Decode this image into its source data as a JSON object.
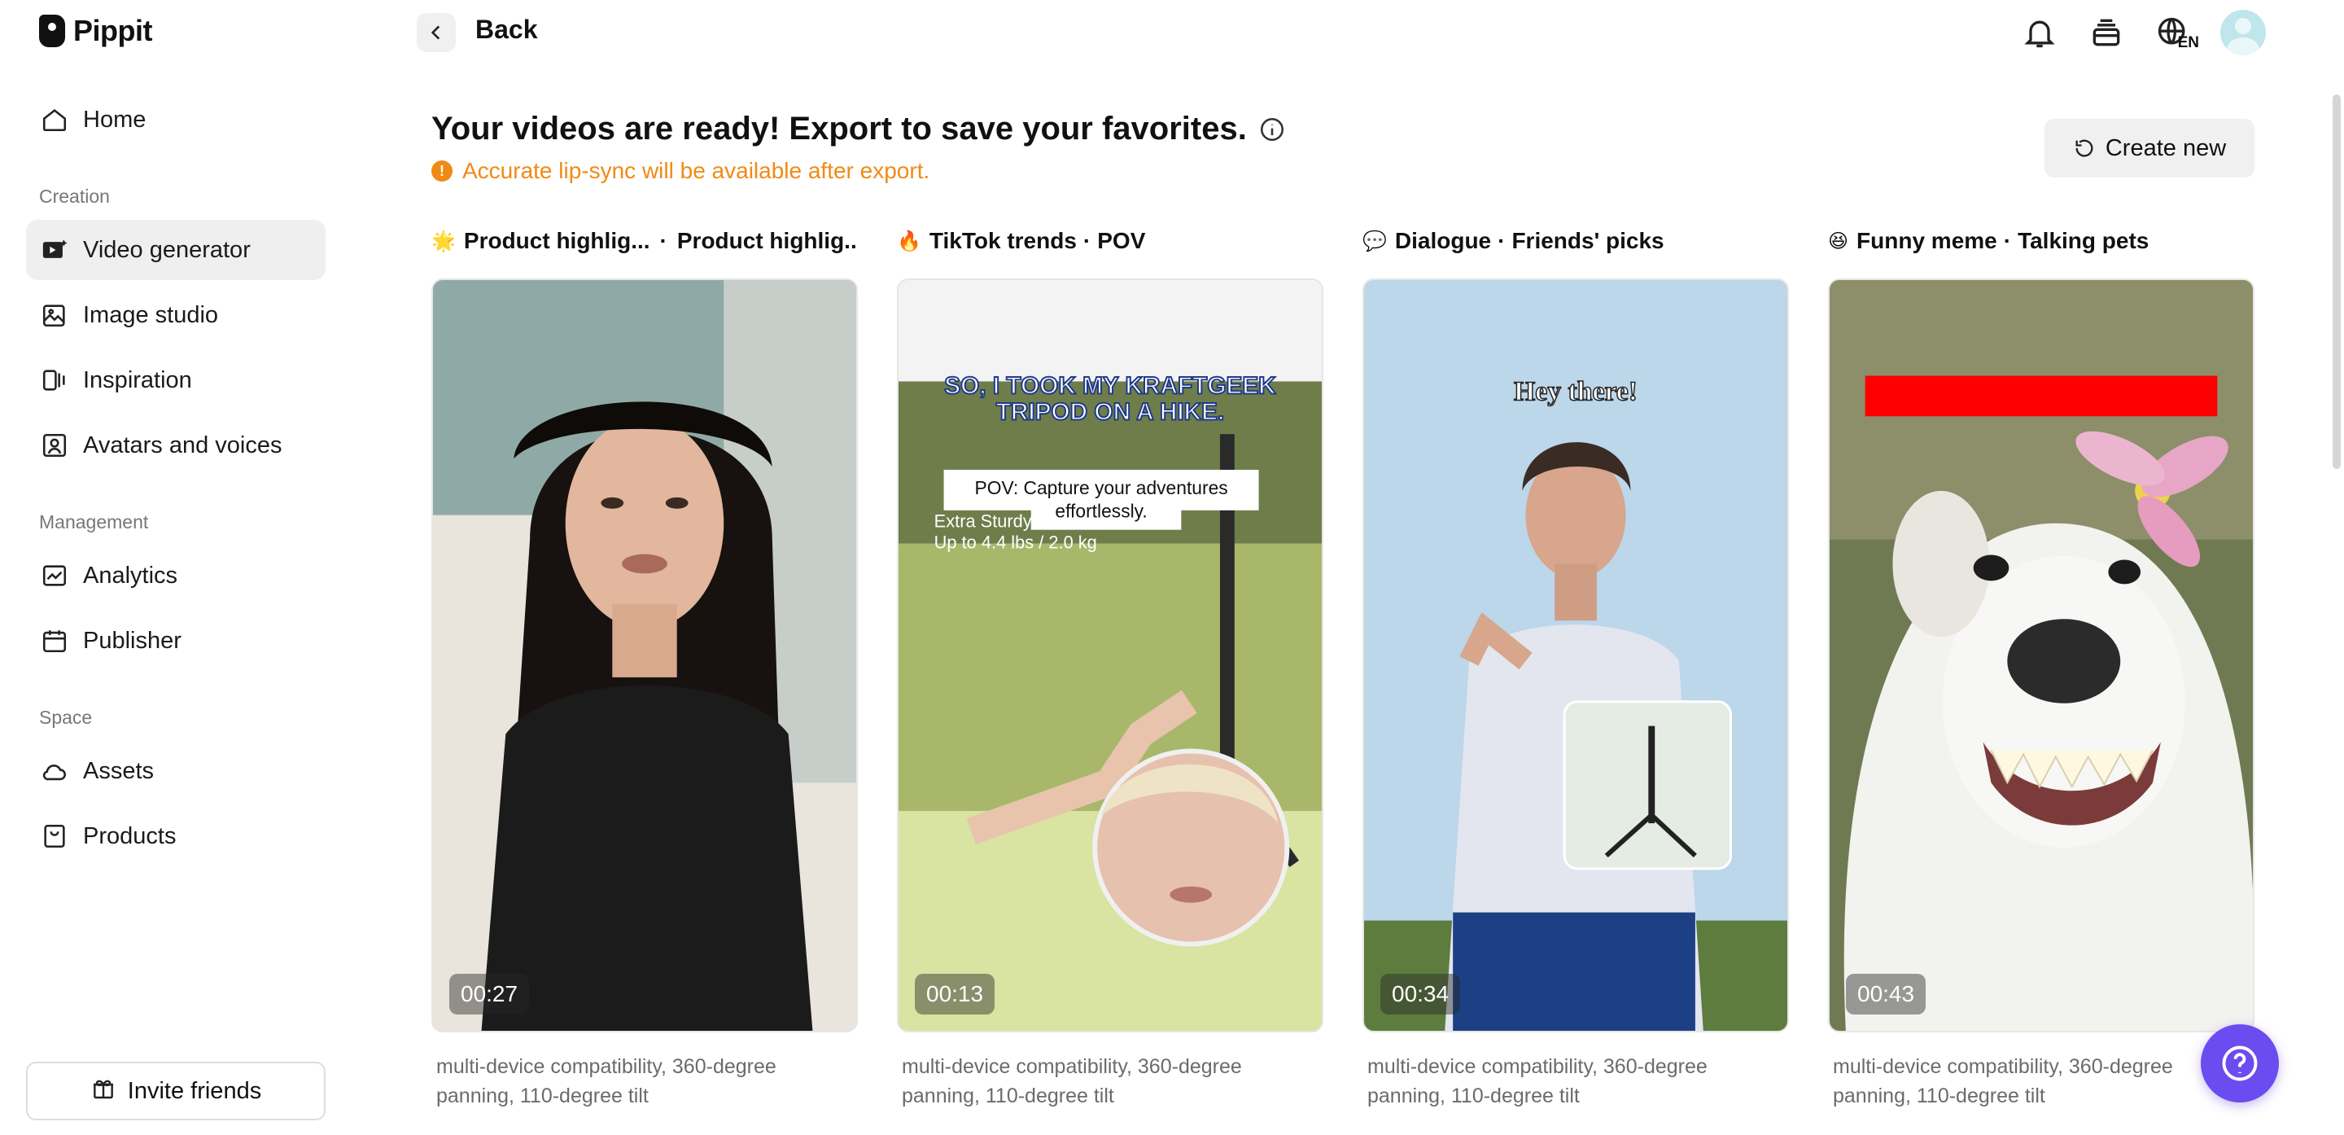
{
  "app": {
    "name": "Pippit"
  },
  "sidebar": {
    "home": "Home",
    "sections": [
      {
        "label": "Creation",
        "items": [
          "Video generator",
          "Image studio",
          "Inspiration",
          "Avatars and voices"
        ]
      },
      {
        "label": "Management",
        "items": [
          "Analytics",
          "Publisher"
        ]
      },
      {
        "label": "Space",
        "items": [
          "Assets",
          "Products"
        ]
      }
    ],
    "active_item": "Video generator",
    "invite_label": "Invite friends"
  },
  "topbar": {
    "back_label": "Back",
    "language": "EN",
    "icons": [
      "bell-icon",
      "stack-icon",
      "globe-icon",
      "avatar"
    ]
  },
  "main": {
    "heading": "Your videos are ready! Export to save your favorites.",
    "notice": "Accurate lip-sync will be available after export.",
    "create_new_label": "Create new",
    "cards": [
      {
        "emoji": "🌟",
        "tag1": "Product highlig...",
        "tag2": "Product highlig...",
        "duration": "00:27",
        "description": "multi-device compatibility, 360-degree panning, 110-degree tilt"
      },
      {
        "emoji": "🔥",
        "tag1": "TikTok trends",
        "tag2": "POV",
        "duration": "00:13",
        "description": "multi-device compatibility, 360-degree panning, 110-degree tilt",
        "overlay_headline": "SO, I TOOK MY KRAFTGEEK TRIPOD ON A HIKE.",
        "overlay_caption": "POV: Capture your adventures effortlessly.",
        "overlay_sub1": "Extra Sturdy",
        "overlay_sub2": "Up to 4.4 lbs / 2.0 kg"
      },
      {
        "emoji": "💬",
        "tag1": "Dialogue",
        "tag2": "Friends' picks",
        "duration": "00:34",
        "description": "multi-device compatibility, 360-degree panning, 110-degree tilt",
        "overlay_headline": "Hey there!"
      },
      {
        "emoji": "😆",
        "tag1": "Funny meme",
        "tag2": "Talking pets",
        "duration": "00:43",
        "description": "multi-device compatibility, 360-degree panning, 110-degree tilt"
      }
    ]
  },
  "colors": {
    "accent_orange": "#f08a16",
    "help_purple": "#6a4cf0",
    "active_bg": "#efefef"
  }
}
